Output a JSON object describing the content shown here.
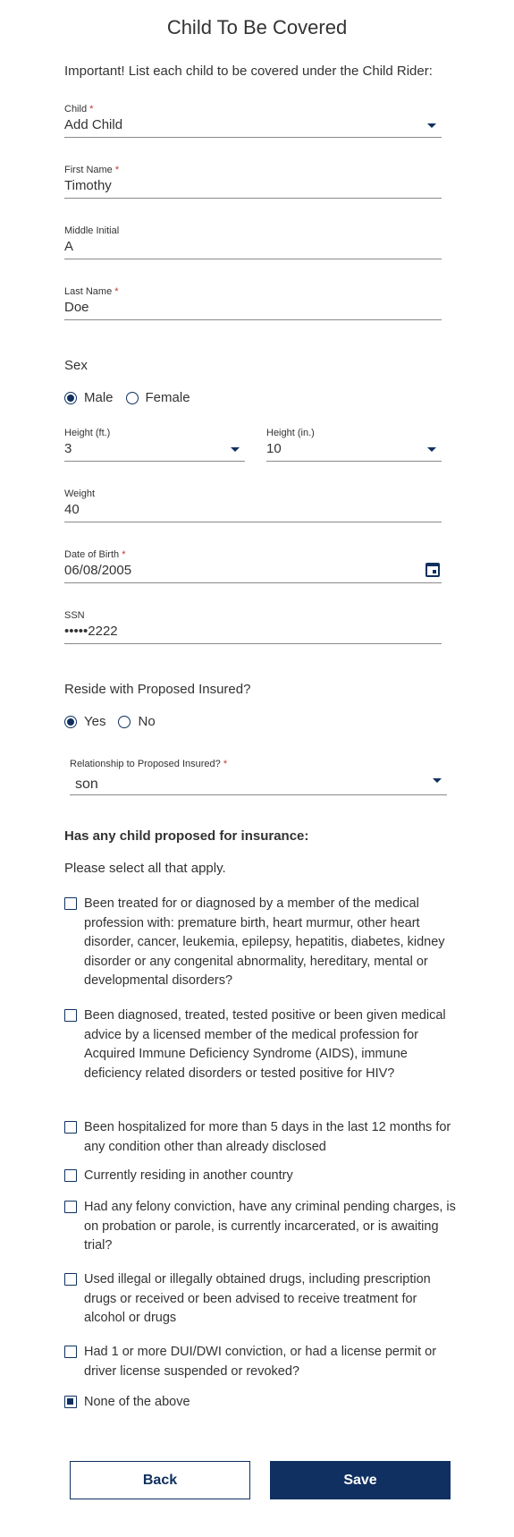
{
  "page": {
    "title": "Child To Be Covered",
    "intro": "Important! List each child to be covered under the Child Rider:"
  },
  "child": {
    "label": "Child",
    "required": "*",
    "value": "Add Child"
  },
  "first_name": {
    "label": "First Name",
    "required": "*",
    "value": "Timothy"
  },
  "middle_initial": {
    "label": "Middle Initial",
    "value": "A"
  },
  "last_name": {
    "label": "Last Name",
    "required": "*",
    "value": "Doe"
  },
  "sex": {
    "label": "Sex",
    "options": [
      "Male",
      "Female"
    ],
    "selected": "Male"
  },
  "height_ft": {
    "label": "Height (ft.)",
    "value": "3"
  },
  "height_in": {
    "label": "Height (in.)",
    "value": "10"
  },
  "weight": {
    "label": "Weight",
    "value": "40"
  },
  "dob": {
    "label": "Date of Birth",
    "required": "*",
    "value": "06/08/2005"
  },
  "ssn": {
    "label": "SSN",
    "value": "•••••2222"
  },
  "reside": {
    "label": "Reside with Proposed Insured?",
    "options": [
      "Yes",
      "No"
    ],
    "selected": "Yes"
  },
  "relationship": {
    "label": "Relationship to Proposed Insured?",
    "required": "*",
    "value": "son"
  },
  "questions": {
    "heading": "Has any child proposed for insurance:",
    "instruction": "Please select all that apply.",
    "items": [
      {
        "text": "Been treated for or diagnosed by a member of the medical profession with: premature birth, heart murmur, other heart disorder, cancer, leukemia, epilepsy, hepatitis, diabetes, kidney disorder or any congenital abnormality, hereditary, mental or developmental disorders?",
        "checked": false
      },
      {
        "text": "Been diagnosed, treated, tested positive or been given medical advice by a licensed member of the medical profession for Acquired Immune Deficiency Syndrome (AIDS), immune deficiency related disorders or tested positive for HIV?",
        "checked": false
      },
      {
        "text": "Been hospitalized for more than 5 days in the last 12 months for any condition other than already disclosed",
        "checked": false
      },
      {
        "text": "Currently residing in another country",
        "checked": false
      },
      {
        "text": "Had any felony conviction, have any criminal pending charges, is on probation or parole, is currently incarcerated, or is awaiting trial?",
        "checked": false
      },
      {
        "text": "Used illegal or illegally obtained drugs, including prescription drugs or received or been advised to receive treatment for alcohol or drugs",
        "checked": false
      },
      {
        "text": "Had 1 or more DUI/DWI conviction, or had a license permit or driver license suspended or revoked?",
        "checked": false
      },
      {
        "text": "None of the above",
        "checked": true
      }
    ]
  },
  "buttons": {
    "back": "Back",
    "save": "Save"
  },
  "colors": {
    "accent": "#0f3060",
    "required": "#c0392b",
    "text": "#333333"
  }
}
